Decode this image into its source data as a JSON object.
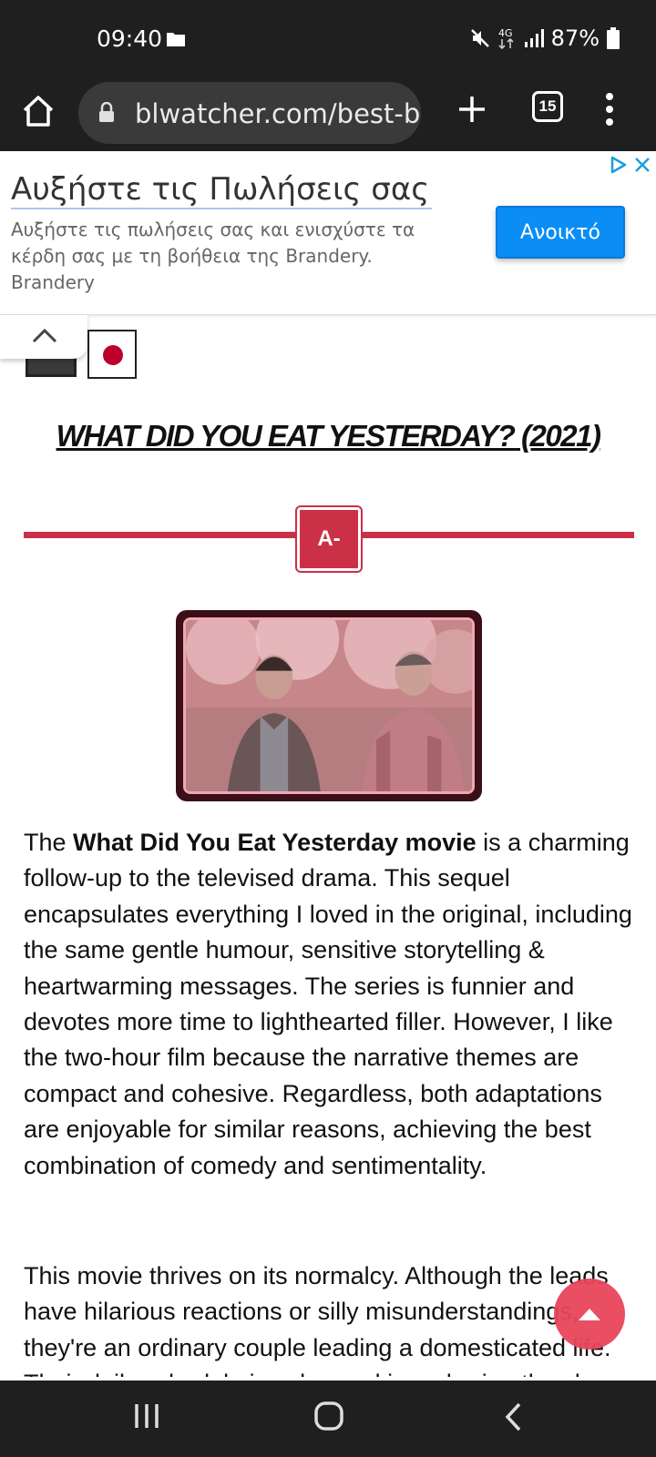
{
  "status_bar": {
    "time": "09:40",
    "network": "4G",
    "battery": "87%",
    "icons": [
      "folder-icon",
      "mute-icon",
      "data-arrows-icon",
      "signal-icon",
      "battery-icon"
    ]
  },
  "browser": {
    "url": "blwatcher.com/best-b",
    "tab_count": "15",
    "icons": [
      "home-icon",
      "lock-icon",
      "plus-icon",
      "tabs-icon",
      "more-vert-icon"
    ]
  },
  "ad": {
    "title": "Αυξήστε τις Πωλήσεις σας",
    "description": "Αυξήστε τις πωλήσεις σας και ενισχύστε τα κέρδη σας με τη βοήθεια της Brandery.",
    "brand": "Brandery",
    "open_label": "Ανοικτό",
    "accent": "#0a8df5"
  },
  "review": {
    "title": "WHAT DID YOU EAT YESTERDAY? (2021)",
    "grade": "A-",
    "accent": "#cc3047",
    "para1_lead": "The ",
    "para1_bold": "What Did You Eat Yesterday movie",
    "para1_rest": " is a charming follow-up to the televised drama. This sequel encapsulates everything I loved in the original, including the same gentle humour, sensitive storytelling & heartwarming messages. The series is funnier and devotes more time to lighthearted filler. However, I like the two-hour film because the narrative themes are compact and cohesive. Regardless, both adaptations are enjoyable for similar reasons, achieving the best combination of comedy and sentimentality.",
    "para2": "This movie thrives on its normalcy. Although the leads have hilarious reactions or silly misunderstandings, they're an ordinary couple leading a domesticated life. Their daily schedule is calm, and in a sharing the ch"
  },
  "nav": {
    "icons": [
      "recents-icon",
      "home-circle-icon",
      "back-icon"
    ]
  }
}
